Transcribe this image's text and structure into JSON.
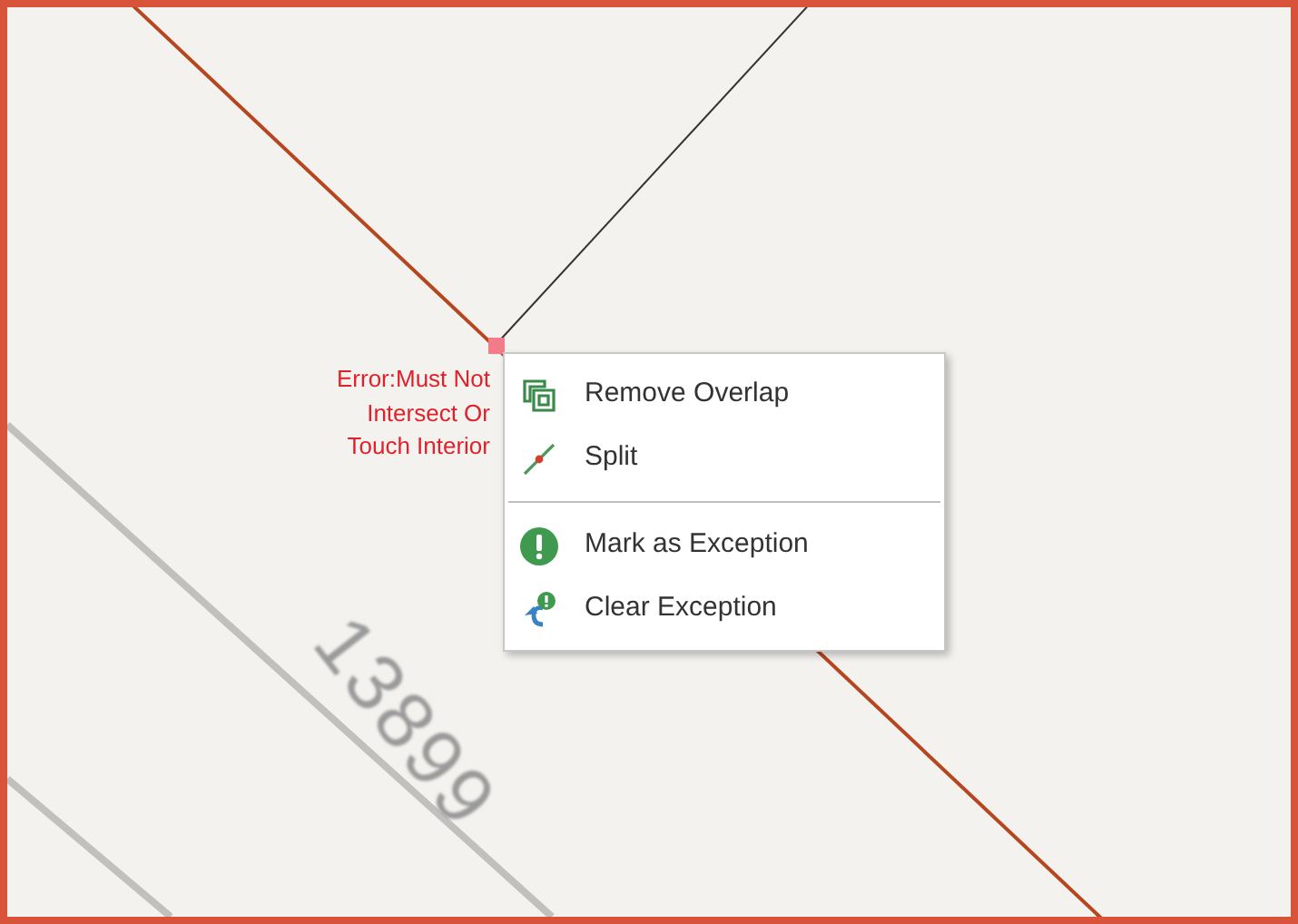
{
  "map": {
    "parcel_label": "13899",
    "error_label": [
      "Error:Must Not",
      "Intersect Or",
      "Touch Interior"
    ]
  },
  "context_menu": {
    "groups": [
      [
        {
          "label": "Remove Overlap"
        },
        {
          "label": "Split"
        }
      ],
      [
        {
          "label": "Mark as Exception"
        },
        {
          "label": "Clear Exception"
        }
      ]
    ]
  }
}
